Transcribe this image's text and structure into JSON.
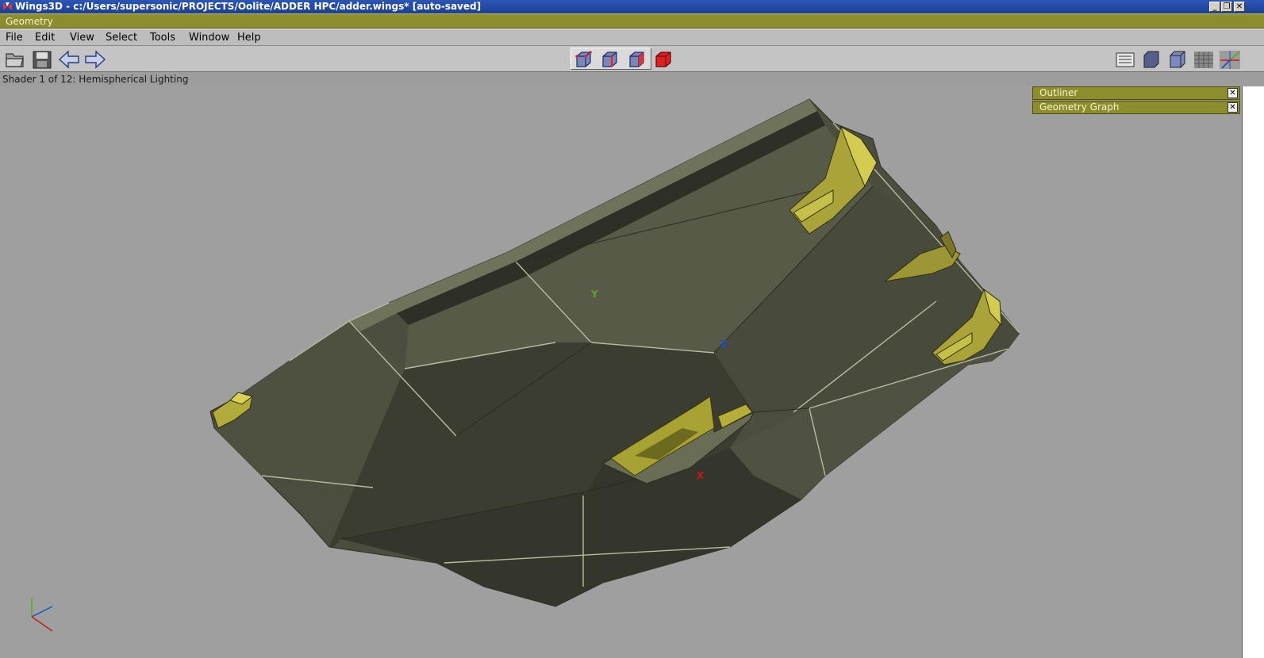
{
  "window": {
    "title": "Wings3D - c:/Users/supersonic/PROJECTS/Oolite/ADDER HPC/adder.wings* [auto-saved]",
    "controls": {
      "minimize": "_",
      "restore": "❐",
      "close": "✕"
    }
  },
  "geometry_header": {
    "label": "Geometry"
  },
  "menu": {
    "items": [
      {
        "label": "File"
      },
      {
        "label": "Edit"
      },
      {
        "label": "View"
      },
      {
        "label": "Select"
      },
      {
        "label": "Tools"
      },
      {
        "label": "Window"
      },
      {
        "label": "Help"
      }
    ]
  },
  "toolbar": {
    "left_icons": [
      "open-folder-icon",
      "save-disk-icon",
      "undo-arrow-icon",
      "redo-arrow-icon"
    ],
    "selection_modes": [
      "vertex-select-icon",
      "edge-select-icon",
      "face-select-icon",
      "object-select-icon"
    ],
    "active_selection_mode": "object",
    "right_icons": [
      "workmode-icon",
      "smooth-shaded-icon",
      "flat-shaded-icon",
      "groundplane-icon",
      "axes-icon"
    ]
  },
  "status": {
    "shader": "Shader 1 of 12: Hemispherical Lighting"
  },
  "viewport": {
    "axis_labels": {
      "x": "X",
      "y": "Y",
      "z": "Z"
    },
    "colors": {
      "background": "#9f9f9f",
      "hull": "#4c4f3f",
      "accent": "#b9b337",
      "x_axis": "#d01818",
      "y_axis": "#5ea51c",
      "z_axis": "#1a4fc8"
    }
  },
  "panels": [
    {
      "label": "Outliner",
      "close": "✕"
    },
    {
      "label": "Geometry Graph",
      "close": "✕"
    }
  ]
}
